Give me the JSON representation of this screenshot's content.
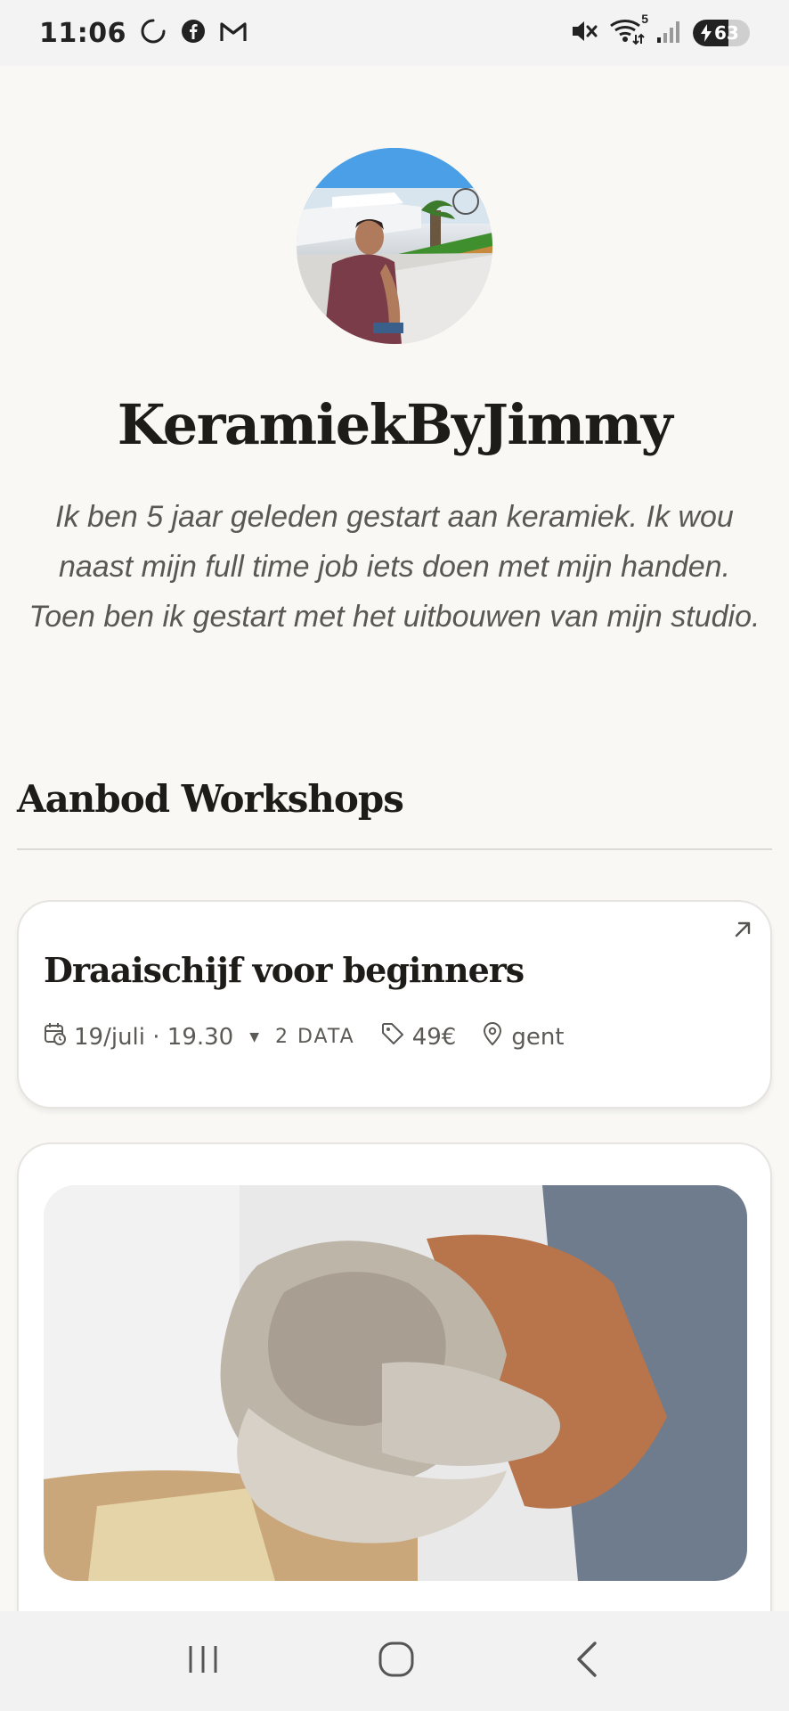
{
  "status_bar": {
    "time": "11:06",
    "battery_level": 63,
    "battery_text": "63",
    "icons": [
      "loading-circle-icon",
      "facebook-icon",
      "gmail-icon",
      "mute-icon",
      "wifi-icon",
      "signal-icon",
      "battery-icon"
    ],
    "wifi_badge": "5"
  },
  "profile": {
    "name": "KeramiekByJimmy",
    "bio": "Ik ben 5 jaar geleden gestart aan keramiek. Ik wou naast mijn full time job iets doen met mijn handen. Toen ben ik gestart met het uitbouwen van mijn studio."
  },
  "section": {
    "title": "Aanbod Workshops"
  },
  "workshops": [
    {
      "title": "Draaischijf voor beginners",
      "date": "19/juli · 19.30",
      "data_count": "2 DATA",
      "price": "49€",
      "location": "gent"
    }
  ],
  "colors": {
    "background": "#f9f8f5",
    "card": "#ffffff",
    "text": "#1e1c18",
    "muted": "#5c5a56"
  }
}
